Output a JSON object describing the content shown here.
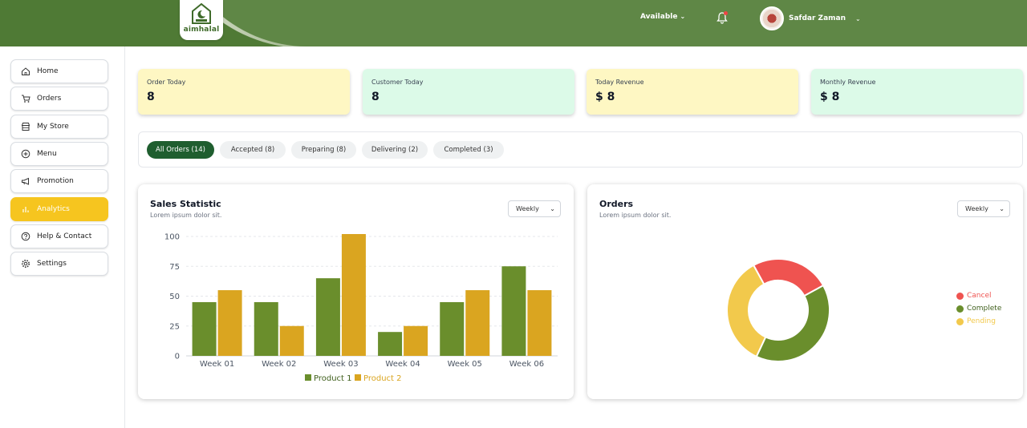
{
  "header": {
    "brand": "aimhalal",
    "availability": "Available",
    "user_name": "Safdar Zaman"
  },
  "sidebar": {
    "items": [
      {
        "label": "Home",
        "icon": "home-icon"
      },
      {
        "label": "Orders",
        "icon": "cart-icon"
      },
      {
        "label": "My Store",
        "icon": "store-icon"
      },
      {
        "label": "Menu",
        "icon": "plus-circle-icon"
      },
      {
        "label": "Promotion",
        "icon": "megaphone-icon"
      },
      {
        "label": "Analytics",
        "icon": "bar-chart-icon",
        "active": true
      },
      {
        "label": "Help & Contact",
        "icon": "help-icon"
      },
      {
        "label": "Settings",
        "icon": "gear-icon"
      }
    ]
  },
  "stats": [
    {
      "label": "Order Today",
      "value": "8",
      "color": "#fef7c3"
    },
    {
      "label": "Customer Today",
      "value": "8",
      "color": "#dcfae8"
    },
    {
      "label": "Today Revenue",
      "value": "$ 8",
      "color": "#fef7c3"
    },
    {
      "label": "Monthly Revenue",
      "value": "$ 8",
      "color": "#dcfae8"
    }
  ],
  "order_tabs": [
    {
      "label": "All Orders (14)",
      "active": true
    },
    {
      "label": "Accepted (8)"
    },
    {
      "label": "Preparing (8)"
    },
    {
      "label": "Delivering (2)"
    },
    {
      "label": "Completed (3)"
    }
  ],
  "sales_panel": {
    "title": "Sales Statistic",
    "subtitle": "Lorem ipsum dolor sit.",
    "period": "Weekly"
  },
  "orders_panel": {
    "title": "Orders",
    "subtitle": "Lorem ipsum dolor sit.",
    "period": "Weekly"
  },
  "colors": {
    "accent_green": "#1f5e2f",
    "product1": "#6a8e2c",
    "product2": "#daa520",
    "cancel": "#ef5350",
    "complete": "#6a8e2c",
    "pending": "#f2c94c",
    "active_nav": "#f6c51f"
  },
  "chart_data": [
    {
      "type": "bar",
      "categories": [
        "Week 01",
        "Week 02",
        "Week 03",
        "Week 04",
        "Week 05",
        "Week 06"
      ],
      "series": [
        {
          "name": "Product 1",
          "values": [
            45,
            45,
            65,
            20,
            45,
            75
          ],
          "color": "#6a8e2c"
        },
        {
          "name": "Product 2",
          "values": [
            55,
            25,
            102,
            25,
            55,
            55
          ],
          "color": "#daa520"
        }
      ],
      "yticks": [
        0,
        25,
        50,
        75,
        100
      ],
      "ylim": [
        0,
        100
      ],
      "grid": true,
      "legend": "bottom"
    },
    {
      "type": "pie",
      "donut": true,
      "labels": [
        "Cancel",
        "Complete",
        "Pending"
      ],
      "values": [
        25,
        40,
        35
      ],
      "colors": [
        "#ef5350",
        "#6a8e2c",
        "#f2c94c"
      ],
      "legend": "right"
    }
  ]
}
